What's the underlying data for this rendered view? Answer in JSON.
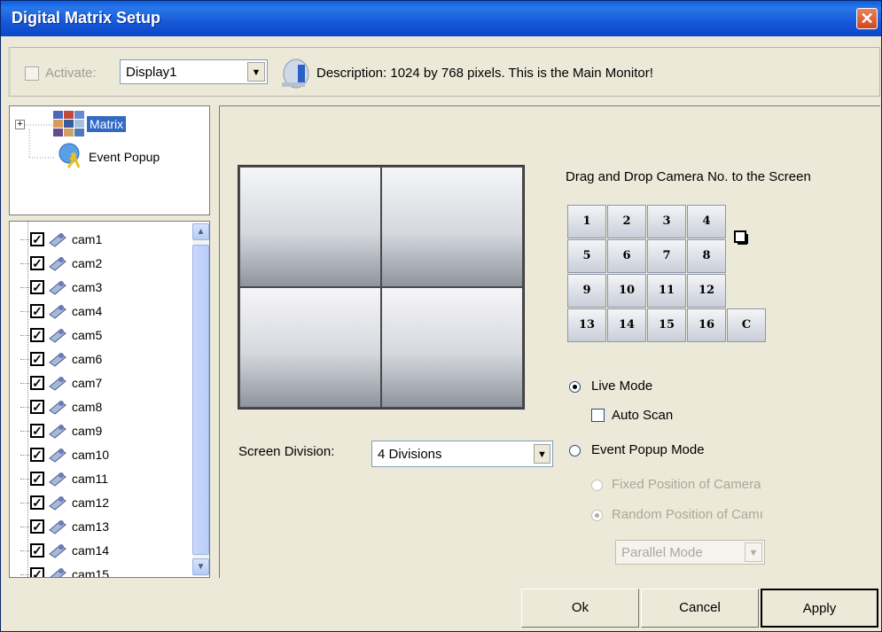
{
  "window": {
    "title": "Digital Matrix Setup",
    "close_glyph": "✕"
  },
  "toolbar": {
    "activate_label": "Activate:",
    "activate_checked": false,
    "display_value": "Display1",
    "description": "Description: 1024 by 768 pixels. This is the Main Monitor!"
  },
  "tree": {
    "items": [
      {
        "label": "Matrix",
        "icon": "matrix-icon",
        "selected": true,
        "expandable": true
      },
      {
        "label": "Event Popup",
        "icon": "event-popup-icon"
      }
    ]
  },
  "cameras": {
    "items": [
      "cam1",
      "cam2",
      "cam3",
      "cam4",
      "cam5",
      "cam6",
      "cam7",
      "cam8",
      "cam9",
      "cam10",
      "cam11",
      "cam12",
      "cam13",
      "cam14",
      "cam15"
    ],
    "checked": true
  },
  "main": {
    "drag_hint": "Drag and Drop Camera No. to the Screen",
    "camera_buttons": [
      "1",
      "2",
      "3",
      "4",
      "5",
      "6",
      "7",
      "8",
      "9",
      "10",
      "11",
      "12",
      "13",
      "14",
      "15",
      "16",
      "C"
    ],
    "screen_division_label": "Screen Division:",
    "screen_division_value": "4 Divisions",
    "live_mode_label": "Live Mode",
    "auto_scan_label": "Auto Scan",
    "event_popup_mode_label": "Event Popup Mode",
    "fixed_position_label": "Fixed Position of Camera",
    "random_position_label": "Random Position of Camı",
    "parallel_mode_value": "Parallel Mode"
  },
  "footer": {
    "ok_label": "Ok",
    "cancel_label": "Cancel",
    "apply_label": "Apply"
  },
  "colors": {
    "titlebar": "#0b47c6",
    "selection": "#316ac5",
    "window_bg": "#ece9d8"
  }
}
